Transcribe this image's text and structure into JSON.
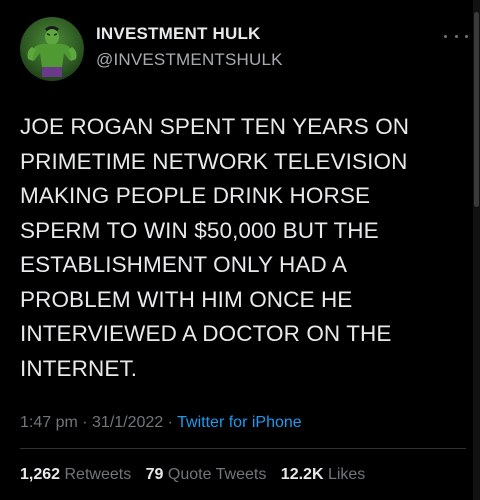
{
  "user": {
    "display_name": "INVESTMENT HULK",
    "handle": "@INVESTMENTSHULK",
    "avatar_icon": "hulk-avatar-icon"
  },
  "more_icon": "more-horizontal-icon",
  "tweet": {
    "text": "JOE ROGAN SPENT TEN YEARS ON\nPRIMETIME NETWORK TELEVISION\nMAKING PEOPLE DRINK HORSE\nSPERM TO WIN $50,000 BUT THE\nESTABLISHMENT ONLY HAD A\nPROBLEM WITH HIM ONCE HE\nINTERVIEWED A DOCTOR ON THE\nINTERNET."
  },
  "meta": {
    "time": "1:47 pm",
    "sep1": " · ",
    "date": "31/1/2022",
    "sep2": " · ",
    "source": "Twitter for iPhone"
  },
  "stats": {
    "retweets_count": "1,262",
    "retweets_label": "Retweets",
    "quotes_count": "79",
    "quotes_label": "Quote Tweets",
    "likes_count": "12.2K",
    "likes_label": "Likes"
  },
  "colors": {
    "background": "#000000",
    "text": "#e7e9ea",
    "secondary": "#71767b",
    "link": "#1d9bf0",
    "divider": "#2f3336"
  }
}
